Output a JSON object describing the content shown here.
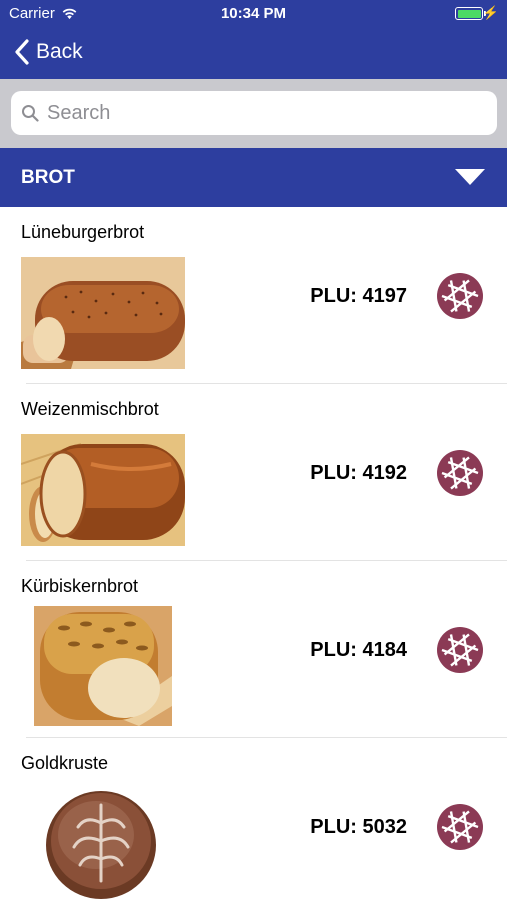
{
  "status_bar": {
    "carrier": "Carrier",
    "time": "10:34 PM",
    "wifi_icon": "wifi-icon",
    "battery_level": 1.0
  },
  "nav": {
    "back_label": "Back"
  },
  "search": {
    "placeholder": "Search",
    "value": ""
  },
  "section": {
    "title": "BROT"
  },
  "colors": {
    "header": "#2d3e9f",
    "camera_button": "#8b3a55",
    "search_bg": "#c9c9ce",
    "battery": "#4cd964"
  },
  "items": [
    {
      "name": "Lüneburgerbrot",
      "plu": "PLU: 4197",
      "image": "bread-loaf-image"
    },
    {
      "name": "Weizenmischbrot",
      "plu": "PLU: 4192",
      "image": "bread-loaf-image"
    },
    {
      "name": "Kürbiskernbrot",
      "plu": "PLU: 4184",
      "image": "seeded-bread-image"
    },
    {
      "name": "Goldkruste",
      "plu": "PLU: 5032",
      "image": "round-bread-image"
    }
  ]
}
